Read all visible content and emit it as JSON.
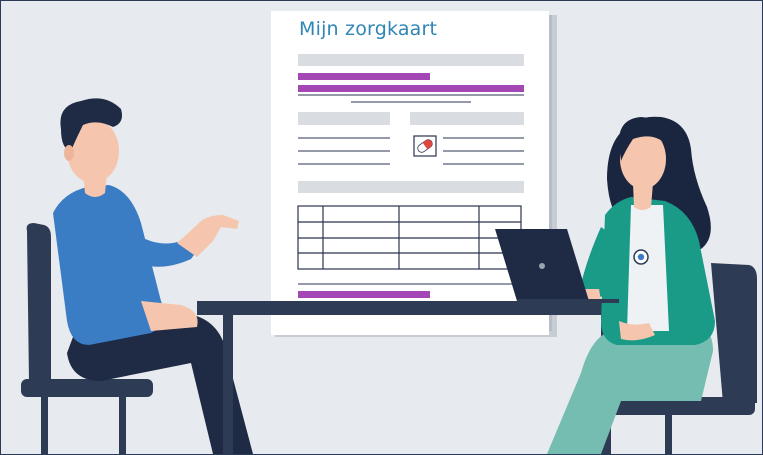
{
  "document": {
    "title": "Mijn zorgkaart"
  },
  "colors": {
    "background": "#e7eaee",
    "paper": "#ffffff",
    "title": "#2f86b5",
    "highlight": "#a247b3",
    "placeholder": "#d9dde2",
    "navy": "#1f2a44",
    "shirt": "#3b7dc4",
    "blazer": "#1a9b88",
    "trousers": "#75bdb1",
    "skin": "#f5c6ad"
  },
  "icons": {
    "document_icon": "pill-icon",
    "badge": "badge-icon"
  }
}
